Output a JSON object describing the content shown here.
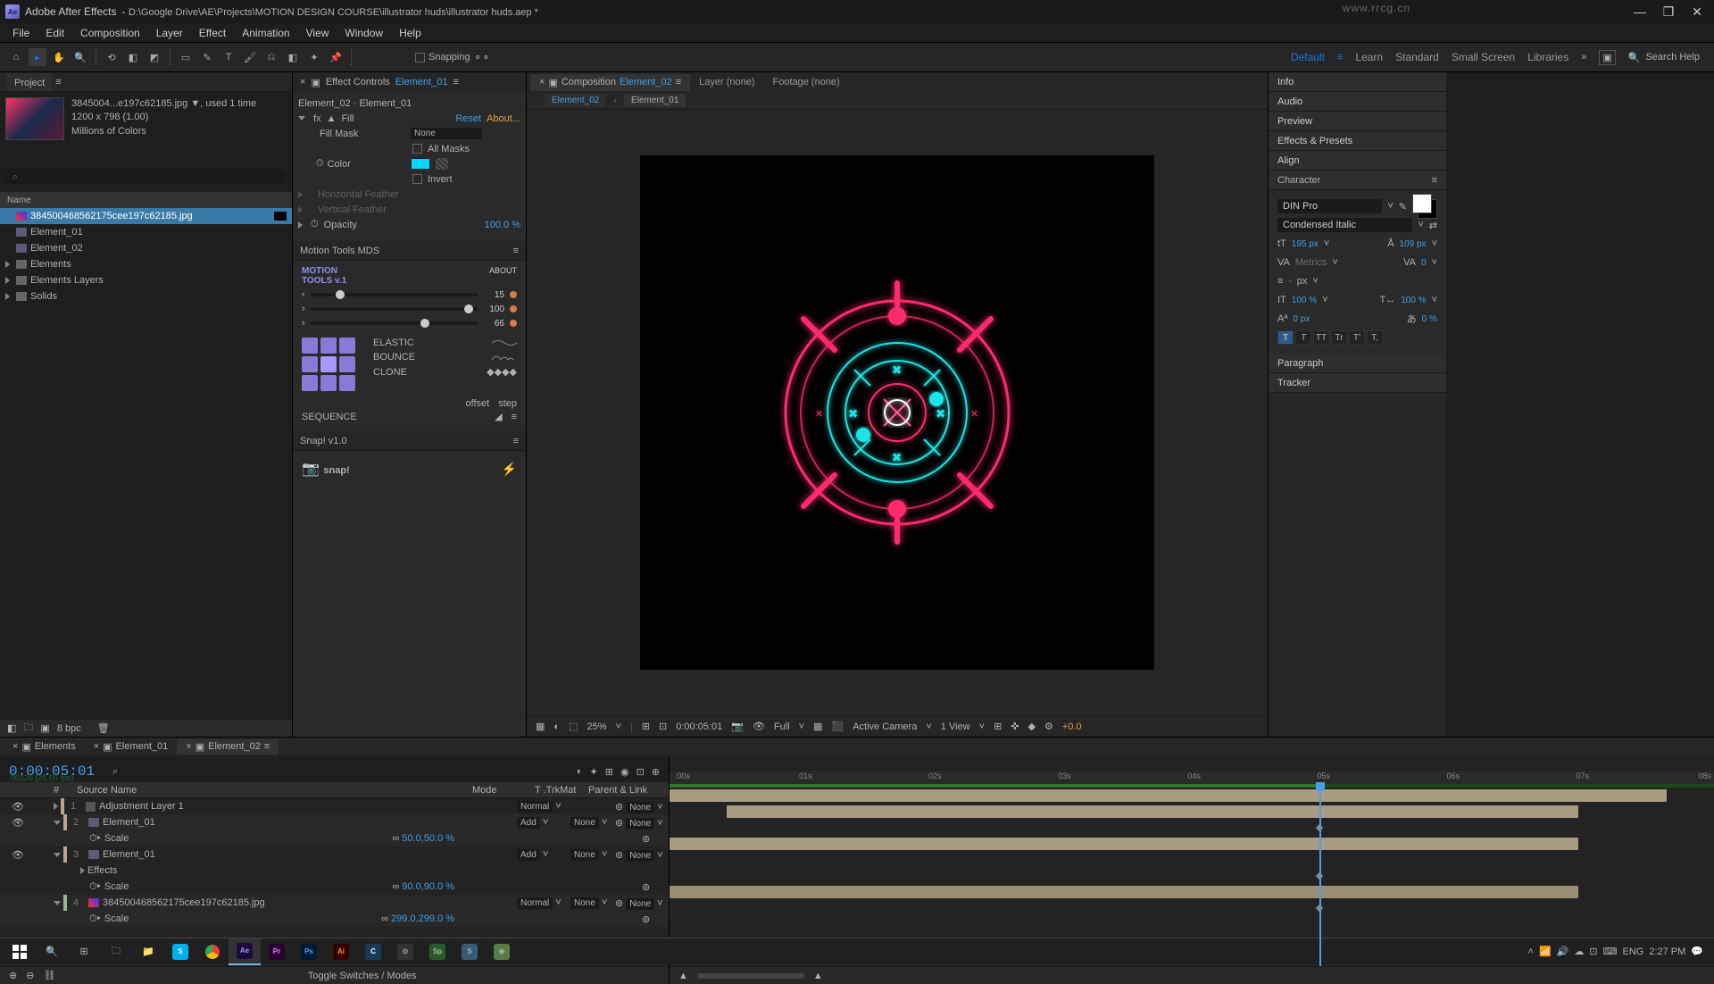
{
  "titlebar": {
    "app": "Adobe After Effects",
    "path": "D:\\Google Drive\\AE\\Projects\\MOTION DESIGN COURSE\\illustrator huds\\illustrator huds.aep *"
  },
  "watermark": "www.rrcg.cn",
  "menu": [
    "File",
    "Edit",
    "Composition",
    "Layer",
    "Effect",
    "Animation",
    "View",
    "Window",
    "Help"
  ],
  "toolbar": {
    "snapping": "Snapping"
  },
  "workspaces": [
    "Default",
    "Learn",
    "Standard",
    "Small Screen",
    "Libraries"
  ],
  "search_placeholder": "Search Help",
  "project": {
    "title": "Project",
    "thumb_name": "3845004...e197c62185.jpg ▼",
    "thumb_used": ", used 1 time",
    "thumb_dims": "1200 x 798 (1.00)",
    "thumb_colors": "Millions of Colors",
    "col_name": "Name",
    "items": [
      {
        "name": "384500468562175cee197c62185.jpg",
        "type": "img",
        "selected": true
      },
      {
        "name": "Element_01",
        "type": "comp"
      },
      {
        "name": "Element_02",
        "type": "comp"
      },
      {
        "name": "Elements",
        "type": "folder"
      },
      {
        "name": "Elements Layers",
        "type": "folder"
      },
      {
        "name": "Solids",
        "type": "folder"
      }
    ],
    "bpc": "8 bpc"
  },
  "effect_controls": {
    "title": "Effect Controls",
    "target": "Element_01",
    "breadcrumb": "Element_02 · Element_01",
    "fx_name": "Fill",
    "reset": "Reset",
    "about": "About...",
    "fill_mask": "Fill Mask",
    "fill_mask_val": "None",
    "all_masks": "All Masks",
    "color": "Color",
    "invert": "Invert",
    "h_feather": "Horizontal Feather",
    "v_feather": "Vertical Feather",
    "opacity": "Opacity",
    "opacity_val": "100.0 %"
  },
  "motion_tools": {
    "title": "Motion Tools MDS",
    "logo_l1": "MOTION",
    "logo_l2": "TOOLS v.1",
    "about": "ABOUT",
    "sliders": [
      {
        "v": "15"
      },
      {
        "v": "100"
      },
      {
        "v": "66"
      }
    ],
    "elastic": "ELASTIC",
    "bounce": "BOUNCE",
    "clone": "CLONE",
    "offset": "offset",
    "step": "step",
    "sequence": "SEQUENCE"
  },
  "snap": {
    "title": "Snap! v1.0",
    "logo": "snap!"
  },
  "composition": {
    "panel": "Composition",
    "target": "Element_02",
    "layer_none": "Layer (none)",
    "footage_none": "Footage (none)",
    "sub_tabs": [
      "Element_02",
      "Element_01"
    ],
    "footer": {
      "zoom": "25%",
      "time": "0:00:05:01",
      "res": "Full",
      "camera": "Active Camera",
      "views": "1 View",
      "exp": "+0.0"
    }
  },
  "right_panels": {
    "info": "Info",
    "audio": "Audio",
    "preview": "Preview",
    "ep": "Effects & Presets",
    "align": "Align",
    "character": "Character",
    "paragraph": "Paragraph",
    "tracker": "Tracker",
    "font": "DIN Pro",
    "style": "Condensed Italic",
    "size": "195 px",
    "leading": "109 px",
    "kerning": "Metrics",
    "tracking": "0",
    "stroke_unit": "px",
    "scale_h": "100 %",
    "scale_v": "100 %",
    "baseline": "0 px",
    "tsume": "0 %",
    "tt": [
      "T",
      "T",
      "TT",
      "Tr",
      "T'",
      "T,"
    ]
  },
  "timeline": {
    "tabs": [
      "Elements",
      "Element_01",
      "Element_02"
    ],
    "timecode": "0:00:05:01",
    "subtext": "00126 (25.00 fps)",
    "cols": {
      "source": "Source Name",
      "mode": "Mode",
      "trkmat": "T  .TrkMat",
      "parent": "Parent & Link"
    },
    "layers": [
      {
        "n": "1",
        "name": "Adjustment Layer 1",
        "mode": "Normal",
        "trk": "",
        "parent": "None",
        "scale": false
      },
      {
        "n": "2",
        "name": "Element_01",
        "mode": "Add",
        "trk": "None",
        "parent": "None",
        "scale": true,
        "scale_val": "50.0,50.0 %"
      },
      {
        "n": "3",
        "name": "Element_01",
        "mode": "Add",
        "trk": "None",
        "parent": "None",
        "scale": true,
        "scale_val": "90.0,90.0 %",
        "effects": true
      },
      {
        "n": "4",
        "name": "384500468562175cee197c62185.jpg",
        "mode": "Normal",
        "trk": "None",
        "parent": "None",
        "scale": true,
        "scale_val": "299.0,299.0 %"
      }
    ],
    "ruler": [
      ":00s",
      "01s",
      "02s",
      "03s",
      "04s",
      "05s",
      "06s",
      "07s",
      "08s"
    ],
    "toggle": "Toggle Switches / Modes"
  },
  "taskbar": {
    "lang": "ENG",
    "time": "2:27 PM"
  }
}
